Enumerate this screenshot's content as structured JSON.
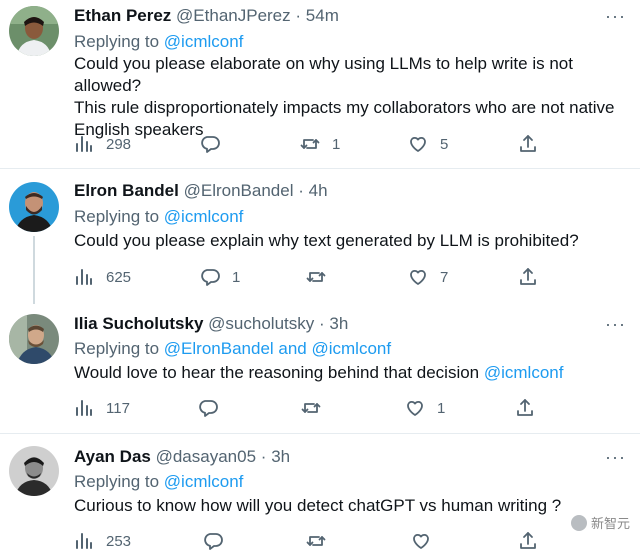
{
  "tweets": [
    {
      "name": "Ethan Perez",
      "handle": "@EthanJPerez",
      "time": "54m",
      "replying_label": "Replying to",
      "mentions_text": "@icmlconf",
      "body_lines": [
        "Could you please elaborate on why using LLMs to help write is not allowed?",
        "This rule disproportionately impacts my collaborators who are not native",
        "English speakers"
      ],
      "stats": {
        "views": "298",
        "replies": "",
        "retweets": "1",
        "likes": "5"
      },
      "avatar_bg": "#6c8f6a"
    },
    {
      "name": "Elron Bandel",
      "handle": "@ElronBandel",
      "time": "4h",
      "replying_label": "Replying to",
      "mentions_text": "@icmlconf",
      "body_lines": [
        "Could you please explain why text generated by LLM is prohibited?"
      ],
      "stats": {
        "views": "625",
        "replies": "1",
        "retweets": "",
        "likes": "7"
      },
      "avatar_bg": "#2a9bd8"
    },
    {
      "name": "Ilia Sucholutsky",
      "handle": "@sucholutsky",
      "time": "3h",
      "replying_label": "Replying to",
      "mentions_text": "@ElronBandel and @icmlconf",
      "body_text": "Would love to hear the reasoning behind that decision ",
      "body_mention": "@icmlconf",
      "stats": {
        "views": "117",
        "replies": "",
        "retweets": "",
        "likes": "1"
      },
      "avatar_bg": "#7a8a7c"
    },
    {
      "name": "Ayan Das",
      "handle": "@dasayan05",
      "time": "3h",
      "replying_label": "Replying to",
      "mentions_text": "@icmlconf",
      "body_lines": [
        "Curious to know how will you detect chatGPT vs human writing ?"
      ],
      "stats": {
        "views": "253",
        "replies": "",
        "retweets": "",
        "likes": ""
      },
      "avatar_bg": "#3a3a3a"
    }
  ],
  "dot": "·",
  "more": "···",
  "watermark": "新智元",
  "colors": {
    "link": "#1d9bf0",
    "muted": "#536471",
    "text": "#0f1419"
  }
}
